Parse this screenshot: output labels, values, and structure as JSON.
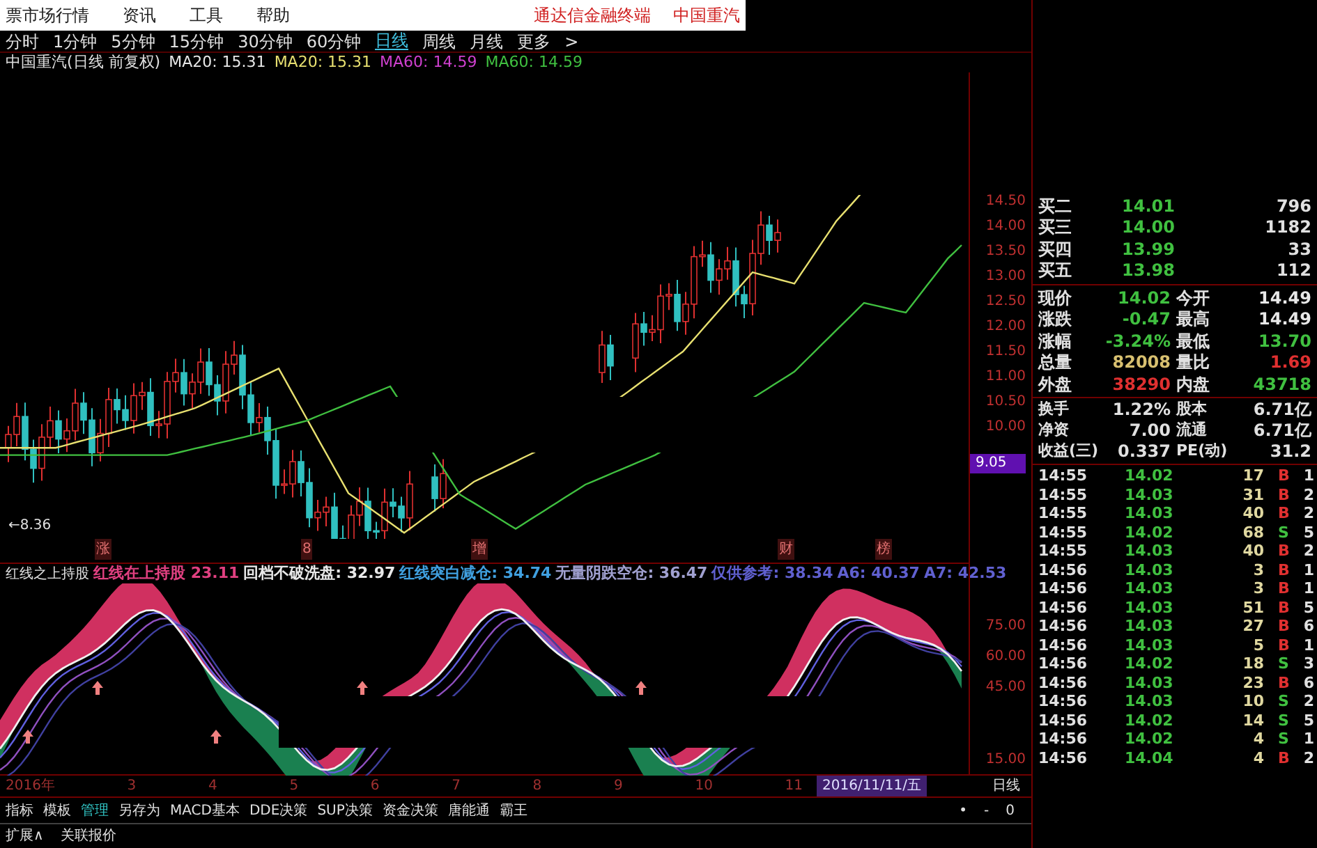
{
  "menu_bar": {
    "items": [
      "票市场行情",
      "资讯",
      "工具",
      "帮助"
    ],
    "right_texts": [
      "通达信金融终端",
      "中国重汽"
    ]
  },
  "period_tabs": [
    {
      "label": "分时",
      "selected": false
    },
    {
      "label": "1分钟",
      "selected": false
    },
    {
      "label": "5分钟",
      "selected": false
    },
    {
      "label": "15分钟",
      "selected": false
    },
    {
      "label": "30分钟",
      "selected": false
    },
    {
      "label": "60分钟",
      "selected": false
    },
    {
      "label": "日线",
      "selected": true
    },
    {
      "label": "周线",
      "selected": false
    },
    {
      "label": "月线",
      "selected": false
    },
    {
      "label": "更多",
      "selected": false
    }
  ],
  "more_arrow": ">",
  "chart_header": {
    "title": "中国重汽(日线 前复权)",
    "indicators": [
      {
        "text": "MA20: 15.31",
        "color": "#e8e8e8"
      },
      {
        "text": "MA20: 15.31",
        "color": "#e8e070"
      },
      {
        "text": "MA60: 14.59",
        "color": "#d040d0"
      },
      {
        "text": "MA60: 14.59",
        "color": "#40c040"
      }
    ]
  },
  "low_marker": "←8.36",
  "event_markers": [
    "涨",
    "8",
    "增",
    "财",
    "榜"
  ],
  "price_axis": {
    "labels": [
      "14.50",
      "14.00",
      "13.50",
      "13.00",
      "12.50",
      "12.00",
      "11.50",
      "11.00",
      "10.50",
      "10.00"
    ],
    "current_price": "9.05"
  },
  "indicator_header": {
    "name": "红线之上持股",
    "items": [
      {
        "text": "红线在上持股  23.11",
        "color": "#e04080"
      },
      {
        "text": "回档不破洗盘: 32.97",
        "color": "#e8e8e8"
      },
      {
        "text": "红线突白减仓: 34.74",
        "color": "#40a0e0"
      },
      {
        "text": "无量阴跌空仓: 36.47",
        "color": "#a0a0d0"
      },
      {
        "text": "仅供参考: 38.34",
        "color": "#6060d0"
      },
      {
        "text": "A6: 40.37",
        "color": "#6060d0"
      },
      {
        "text": "A7: 42.53",
        "color": "#6060d0"
      }
    ]
  },
  "indicator_axis": [
    "75.00",
    "60.00",
    "45.00",
    "15.00"
  ],
  "date_axis": {
    "labels": [
      "2016年",
      "3",
      "4",
      "5",
      "6",
      "7",
      "8",
      "9",
      "10",
      "11"
    ],
    "cursor_date": "2016/11/11/五",
    "period": "日线"
  },
  "bottom_tabs": [
    {
      "label": "指标",
      "selected": false
    },
    {
      "label": "模板",
      "selected": false
    },
    {
      "label": "管理",
      "selected": true
    },
    {
      "label": "另存为",
      "selected": false
    },
    {
      "label": "MACD基本",
      "selected": false
    },
    {
      "label": "DDE决策",
      "selected": false
    },
    {
      "label": "SUP决策",
      "selected": false
    },
    {
      "label": "资金决策",
      "selected": false
    },
    {
      "label": "唐能通",
      "selected": false
    },
    {
      "label": "霸王",
      "selected": false
    }
  ],
  "zoom_controls": [
    "•",
    "-",
    "0"
  ],
  "footer": [
    "扩展∧",
    "关联报价"
  ],
  "quote_panel": {
    "bids": [
      {
        "label": "买二",
        "price": "14.01",
        "volume": "796"
      },
      {
        "label": "买三",
        "price": "14.00",
        "volume": "1182"
      },
      {
        "label": "买四",
        "price": "13.99",
        "volume": "33"
      },
      {
        "label": "买五",
        "price": "13.98",
        "volume": "112"
      }
    ],
    "stats": [
      {
        "left": {
          "label": "现价",
          "value": "14.02",
          "color": "#40c040"
        },
        "right": {
          "label": "今开",
          "value": "14.49",
          "color": "#e8e8e8"
        }
      },
      {
        "left": {
          "label": "涨跌",
          "value": "-0.47",
          "color": "#40c040"
        },
        "right": {
          "label": "最高",
          "value": "14.49",
          "color": "#e8e8e8"
        }
      },
      {
        "left": {
          "label": "涨幅",
          "value": "-3.24%",
          "color": "#40c040"
        },
        "right": {
          "label": "最低",
          "value": "13.70",
          "color": "#40c040"
        }
      },
      {
        "left": {
          "label": "总量",
          "value": "82008",
          "color": "#d8c070"
        },
        "right": {
          "label": "量比",
          "value": "1.69",
          "color": "#e03030"
        }
      },
      {
        "left": {
          "label": "外盘",
          "value": "38290",
          "color": "#e03030"
        },
        "right": {
          "label": "内盘",
          "value": "43718",
          "color": "#40c040"
        }
      }
    ],
    "stats2": [
      {
        "label": "换手",
        "value": "1.22%",
        "label2": "股本",
        "value2": "6.71亿"
      },
      {
        "label": "净资",
        "value": "7.00",
        "label2": "流通",
        "value2": "6.71亿"
      },
      {
        "label": "收益(三)",
        "value": "0.337",
        "label2": "PE(动)",
        "value2": "31.2"
      }
    ],
    "ticks": [
      {
        "time": "14:55",
        "price": "14.02",
        "volume": "17",
        "side": "B",
        "kind": "buy",
        "column_5": "1"
      },
      {
        "time": "14:55",
        "price": "14.03",
        "volume": "31",
        "side": "B",
        "kind": "buy",
        "column_5": "2"
      },
      {
        "time": "14:55",
        "price": "14.03",
        "volume": "40",
        "side": "B",
        "kind": "buy",
        "column_5": "2"
      },
      {
        "time": "14:55",
        "price": "14.02",
        "volume": "68",
        "side": "S",
        "kind": "sell",
        "column_5": "5"
      },
      {
        "time": "14:55",
        "price": "14.03",
        "volume": "40",
        "side": "B",
        "kind": "buy",
        "column_5": "2"
      },
      {
        "time": "14:56",
        "price": "14.03",
        "volume": "3",
        "side": "B",
        "kind": "buy",
        "column_5": "1"
      },
      {
        "time": "14:56",
        "price": "14.03",
        "volume": "3",
        "side": "B",
        "kind": "buy",
        "column_5": "1"
      },
      {
        "time": "14:56",
        "price": "14.03",
        "volume": "51",
        "side": "B",
        "kind": "buy",
        "column_5": "5"
      },
      {
        "time": "14:56",
        "price": "14.03",
        "volume": "27",
        "side": "B",
        "kind": "buy",
        "column_5": "6"
      },
      {
        "time": "14:56",
        "price": "14.03",
        "volume": "5",
        "side": "B",
        "kind": "buy",
        "column_5": "1"
      },
      {
        "time": "14:56",
        "price": "14.02",
        "volume": "18",
        "side": "S",
        "kind": "sell",
        "column_5": "3"
      },
      {
        "time": "14:56",
        "price": "14.03",
        "volume": "23",
        "side": "B",
        "kind": "buy",
        "column_5": "6"
      },
      {
        "time": "14:56",
        "price": "14.03",
        "volume": "10",
        "side": "S",
        "kind": "sell",
        "column_5": "2"
      },
      {
        "time": "14:56",
        "price": "14.02",
        "volume": "14",
        "side": "S",
        "kind": "sell",
        "column_5": "5"
      },
      {
        "time": "14:56",
        "price": "14.02",
        "volume": "4",
        "side": "S",
        "kind": "sell",
        "column_5": "1"
      },
      {
        "time": "14:56",
        "price": "14.04",
        "volume": "4",
        "side": "B",
        "kind": "buy",
        "column_5": "2"
      }
    ]
  }
}
